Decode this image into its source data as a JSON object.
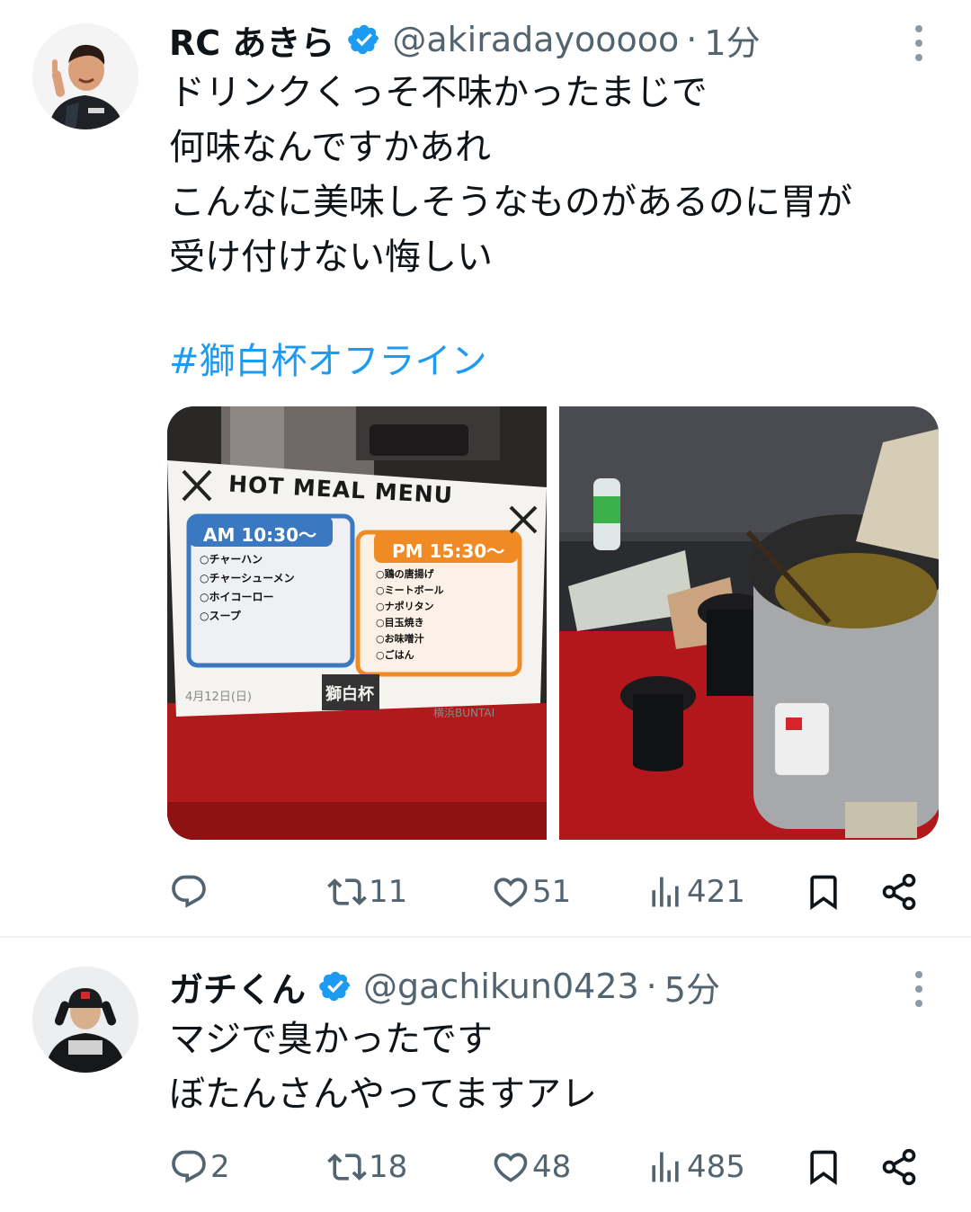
{
  "tweets": [
    {
      "display_name": "RC あきら",
      "handle": "@akiradayooooo",
      "separator": "·",
      "time": "1分",
      "text": "ドリンクくっそ不味かったまじで\n何味なんですかあれ\nこんなに美味しそうなものがあるのに胃が\n受け付けない悔しい",
      "hashtag": "#獅白杯オフライン",
      "media": {
        "left_photo": {
          "sign_title": "HOT MEAL MENU",
          "am_header": "AM 10:30〜",
          "am_items": [
            "○チャーハン",
            "○チャーシューメン",
            "○ホイコーロー",
            "○スープ"
          ],
          "pm_header": "PM 15:30〜",
          "pm_items": [
            "○鶏の唐揚げ",
            "○ミートボール",
            "○ナポリタン",
            "○目玉焼き",
            "○お味噌汁",
            "○ごはん"
          ],
          "date": "4月12日(日)",
          "venue": "横浜BUNTAI",
          "logo_text": "獅白杯"
        }
      },
      "replies": "",
      "retweets": "11",
      "likes": "51",
      "views": "421"
    },
    {
      "display_name": "ガチくん",
      "handle": "@gachikun0423",
      "separator": "·",
      "time": "5分",
      "text": "マジで臭かったです\nぼたんさんやってますアレ",
      "replies": "2",
      "retweets": "18",
      "likes": "48",
      "views": "485"
    }
  ],
  "colors": {
    "text_primary": "#0f1419",
    "text_secondary": "#536471",
    "link": "#1d9bf0",
    "verified": "#1d9bf0",
    "divider": "#eff3f4"
  },
  "icons": [
    "verified-badge-icon",
    "more-icon",
    "reply-icon",
    "retweet-icon",
    "like-icon",
    "views-icon",
    "bookmark-icon",
    "share-icon"
  ]
}
